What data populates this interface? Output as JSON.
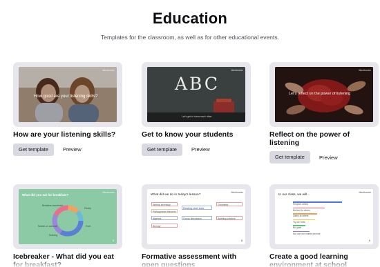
{
  "header": {
    "title": "Education",
    "subtitle": "Templates for the classroom, as well as for other educational events."
  },
  "cards": [
    {
      "title": "How are your listening skills?",
      "thumb_text": "How good are your listening skills?",
      "get_label": "Get template",
      "preview_label": "Preview"
    },
    {
      "title": "Get to know your students",
      "thumb_text": "ABC",
      "thumb_caption": "Let's get to know each other",
      "get_label": "Get template",
      "preview_label": "Preview"
    },
    {
      "title": "Reflect on the power of listening",
      "thumb_text": "Let's reflect on the power of listening",
      "get_label": "Get template",
      "preview_label": "Preview"
    },
    {
      "title": "Icebreaker - What did you eat for breakfast?",
      "thumb_text": "What did you eat for breakfast?",
      "thumb_labels": [
        "Breakfast sandwich",
        "Pastry",
        "Fruit",
        "Muesli or oatmeal",
        "Nothing"
      ],
      "thumb_count": "5"
    },
    {
      "title": "Formative assessment with open questions",
      "thumb_text": "What did we do in today's lesson?",
      "thumb_boxes": [
        "Writing an essay",
        "Reading short texts",
        "Geometry",
        "Pythagorean theorem",
        "Algebra",
        "Group discussion",
        "Spelling practice",
        "Biology"
      ],
      "thumb_count": "8"
    },
    {
      "title": "Create a good learning environment at school",
      "thumb_text": "In our class, we will...",
      "thumb_bars": [
        {
          "label": "Respect others",
          "value": 0.85,
          "color": "#4a73e8"
        },
        {
          "label": "Be kind to others",
          "value": 0.55,
          "color": "#ea5a6f"
        },
        {
          "label": "Listen to others",
          "value": 0.42,
          "color": "#f29b4a"
        },
        {
          "label": "Try our best",
          "value": 0.38,
          "color": "#f2c94a"
        },
        {
          "label": "Be quiet",
          "value": 0.22,
          "color": "#5fbf7a"
        },
        {
          "label": "Not use our mobile phones",
          "value": 0.28,
          "color": "#8f7ae8"
        }
      ],
      "thumb_count": "6"
    }
  ],
  "brand": {
    "logo_text": "Mentimeter"
  },
  "colors": {
    "accent_button": "#d9dae1",
    "card_bg": "#e6e6ec",
    "breakfast_bg": "#8cc9a5"
  }
}
